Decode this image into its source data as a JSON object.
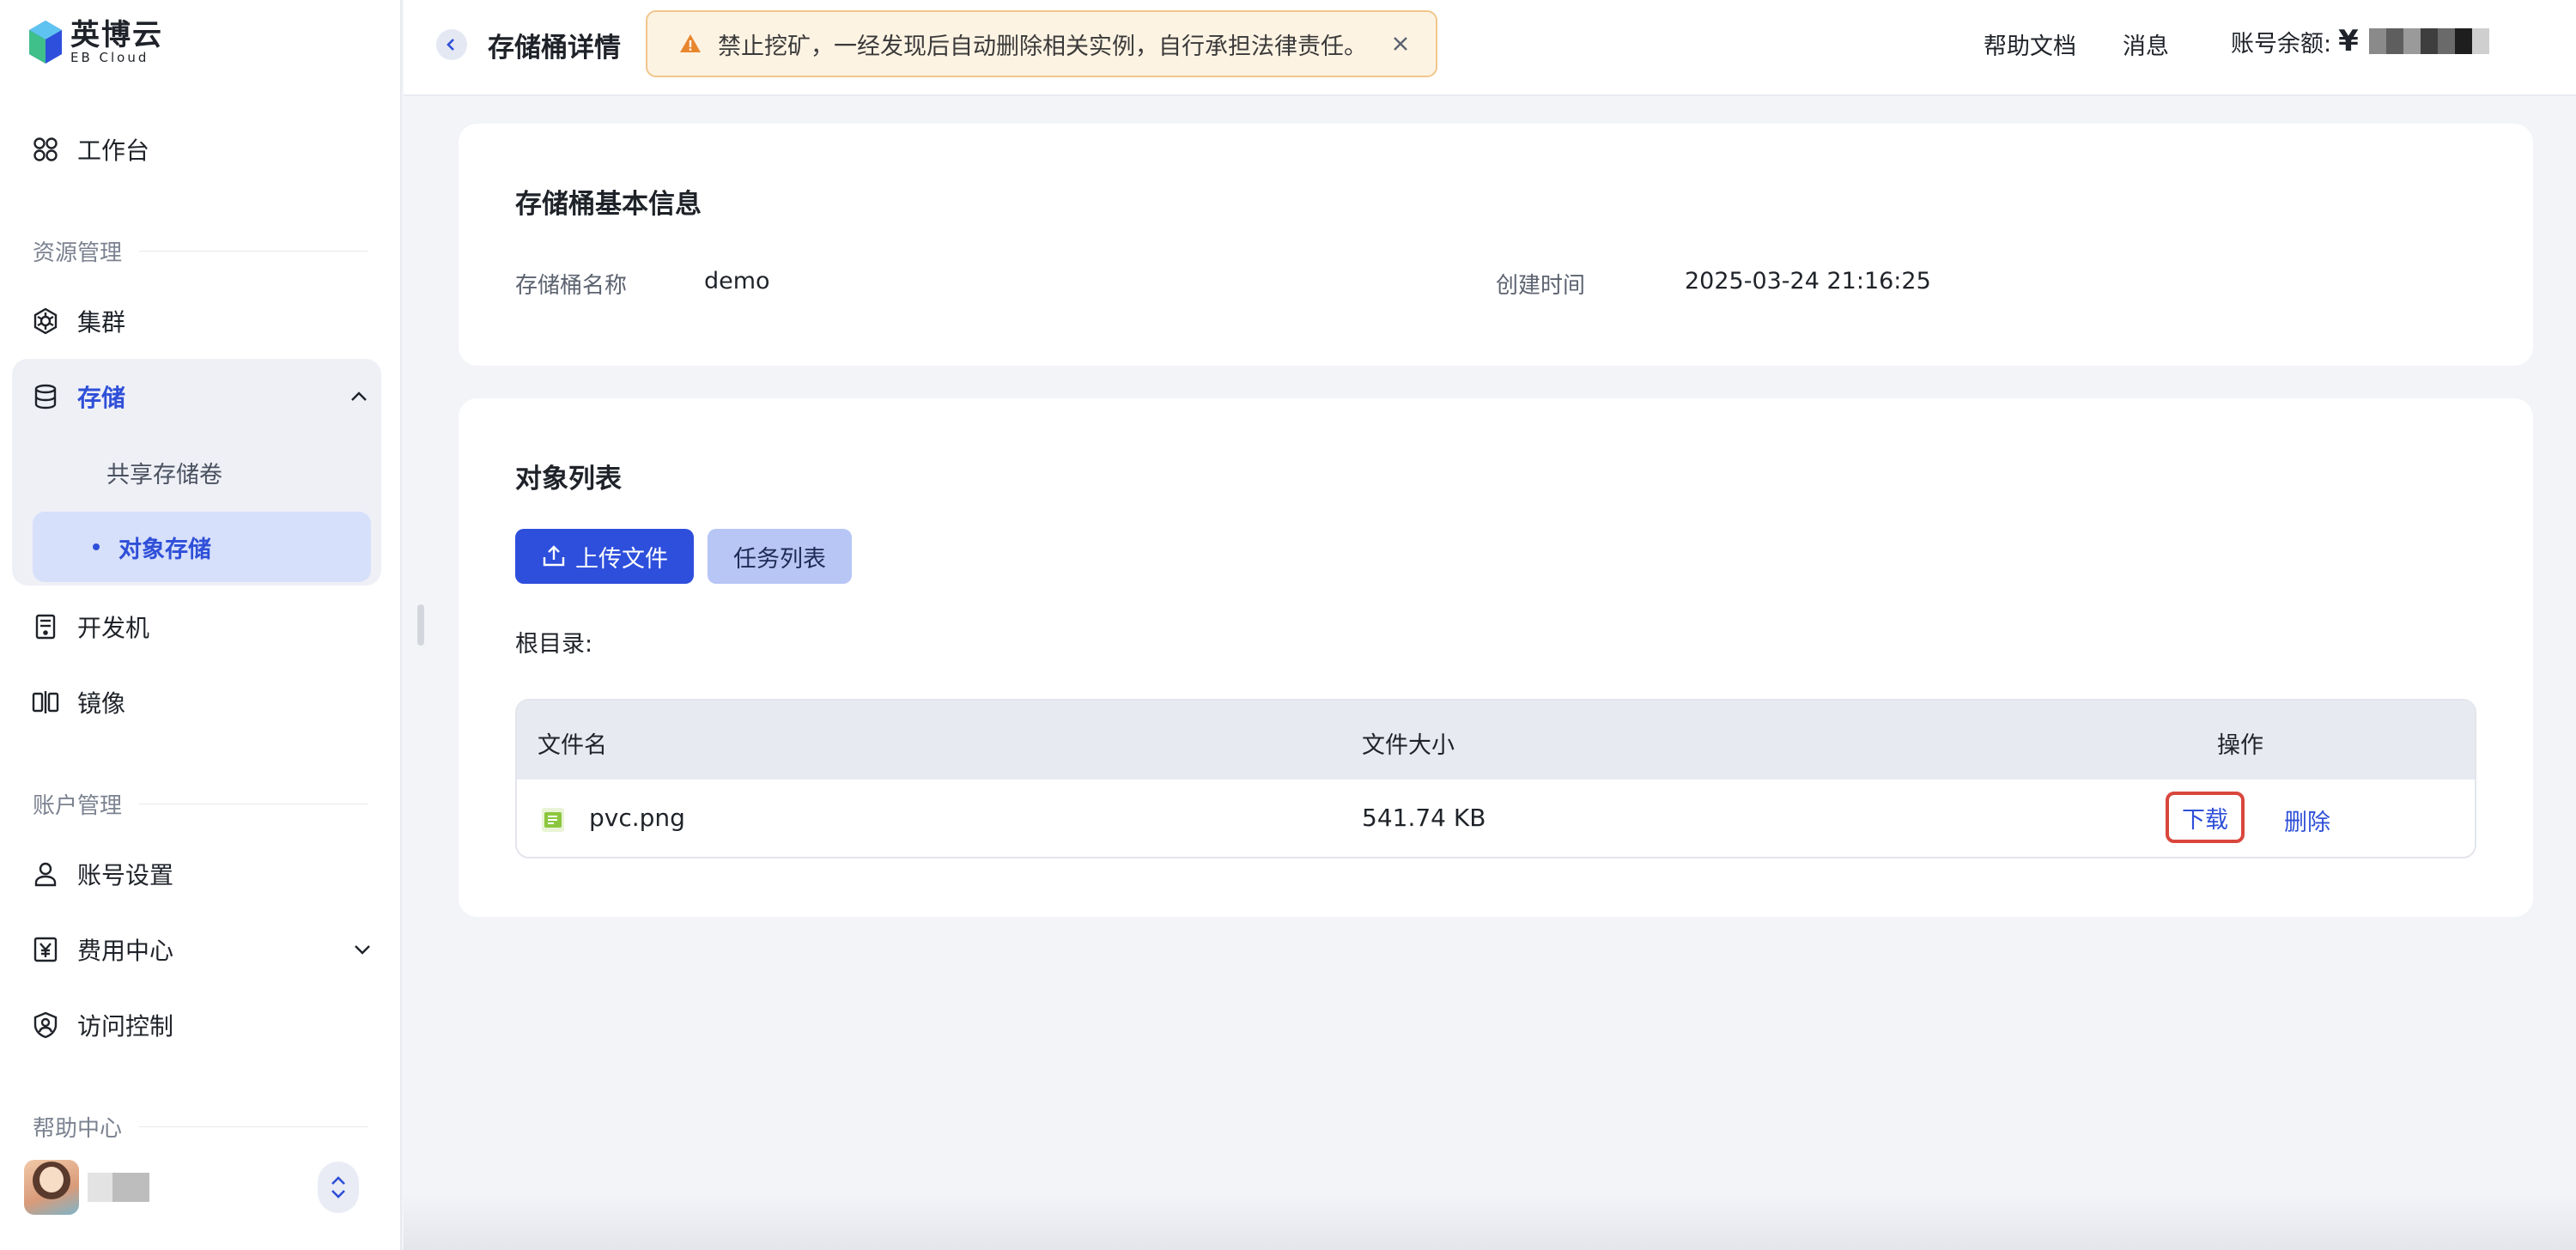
{
  "brand": {
    "name_cn": "英博云",
    "name_en": "EB Cloud"
  },
  "sidebar": {
    "workbench": "工作台",
    "sections": {
      "resource": "资源管理",
      "account": "账户管理",
      "help": "帮助中心"
    },
    "cluster": "集群",
    "storage": "存储",
    "storage_children": [
      "共享存储卷",
      "对象存储"
    ],
    "devbox": "开发机",
    "image": "镜像",
    "account_settings": "账号设置",
    "billing": "费用中心",
    "access_control": "访问控制"
  },
  "header": {
    "title": "存储桶详情",
    "warning": "禁止挖矿，一经发现后自动删除相关实例，自行承担法律责任。",
    "help_docs": "帮助文档",
    "messages": "消息",
    "balance_label": "账号余额:",
    "currency": "¥"
  },
  "bucket_info": {
    "title": "存储桶基本信息",
    "name_label": "存储桶名称",
    "name_value": "demo",
    "created_label": "创建时间",
    "created_value": "2025-03-24 21:16:25"
  },
  "objects": {
    "title": "对象列表",
    "upload_button": "上传文件",
    "tasks_button": "任务列表",
    "root_label": "根目录:",
    "columns": [
      "文件名",
      "文件大小",
      "操作"
    ],
    "rows": [
      {
        "name": "pvc.png",
        "size": "541.74 KB",
        "download": "下载",
        "delete": "删除"
      }
    ]
  },
  "colors": {
    "accent": "#2e4fdc",
    "sidebar_active_bg": "#d7e0fb",
    "warning_bg": "#fdf3e3",
    "warning_icon": "#e8862e",
    "highlight_border": "#d9473c"
  },
  "icons": [
    "workbench-icon",
    "cluster-icon",
    "storage-icon",
    "devbox-icon",
    "image-icon",
    "user-icon",
    "yen-icon",
    "shield-icon",
    "upload-icon",
    "warning-icon",
    "close-icon",
    "back-icon",
    "file-image-icon"
  ]
}
